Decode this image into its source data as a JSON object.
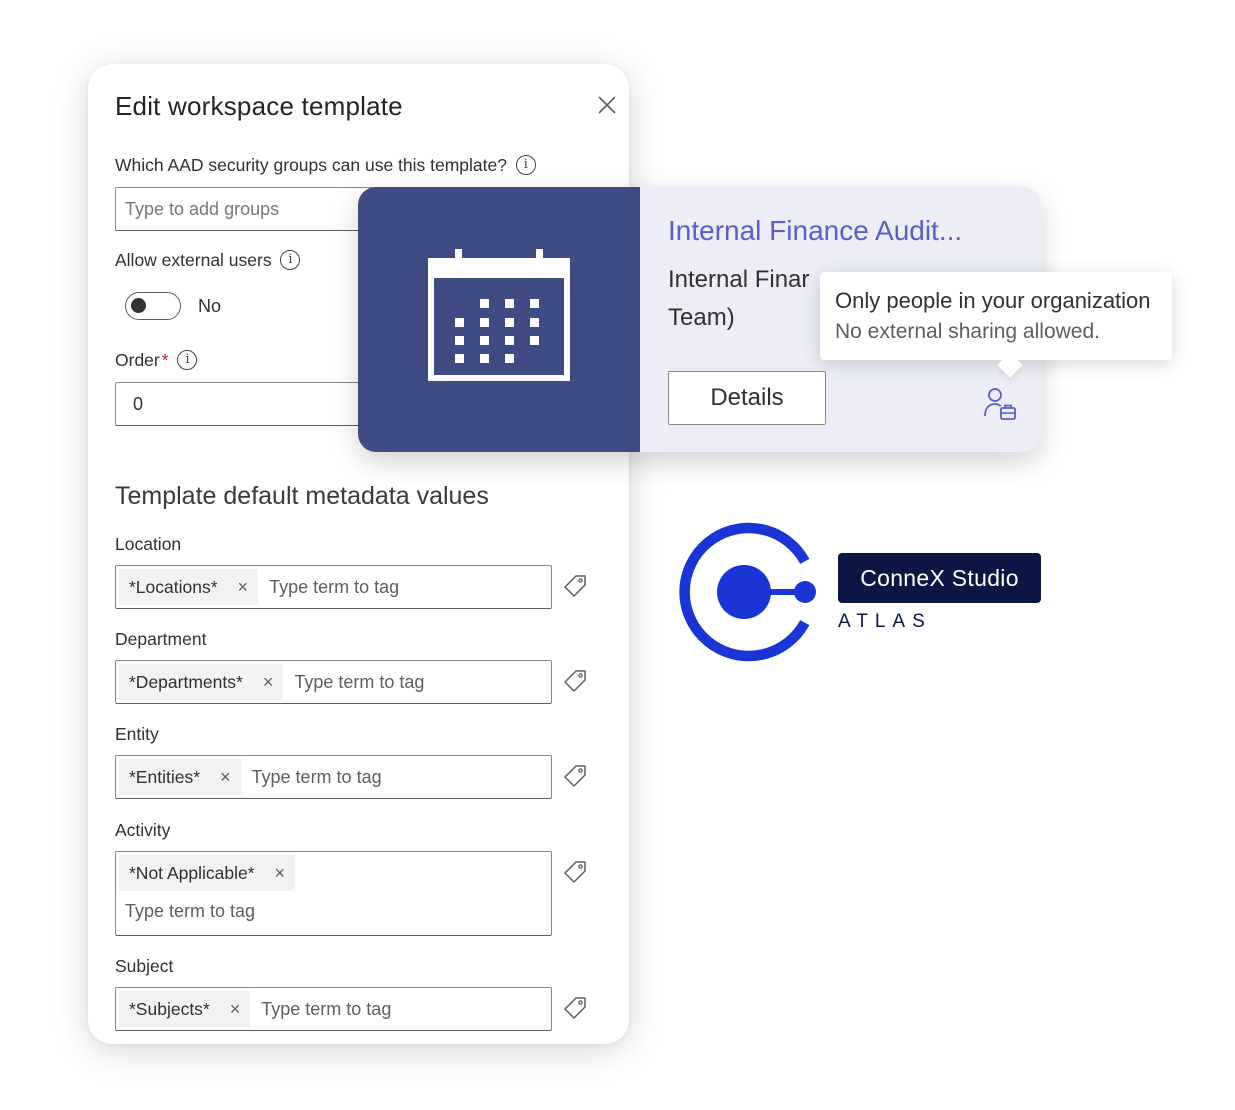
{
  "dialog": {
    "title": "Edit workspace template",
    "groups_label": "Which AAD security groups can use this template?",
    "groups_placeholder": "Type to add groups",
    "external_label": "Allow external users",
    "external_value": "No",
    "order_label": "Order",
    "order_required_mark": "*",
    "order_value": "0",
    "metadata_title": "Template default metadata values",
    "fields": [
      {
        "label": "Location",
        "chip": "*Locations*",
        "placeholder": "Type term to tag"
      },
      {
        "label": "Department",
        "chip": "*Departments*",
        "placeholder": "Type term to tag"
      },
      {
        "label": "Entity",
        "chip": "*Entities*",
        "placeholder": "Type term to tag"
      },
      {
        "label": "Activity",
        "chip": "*Not Applicable*",
        "placeholder": "Type term to tag"
      },
      {
        "label": "Subject",
        "chip": "*Subjects*",
        "placeholder": "Type term to tag"
      }
    ]
  },
  "card": {
    "title": "Internal Finance Audit...",
    "desc_line1": "Internal Finar",
    "desc_line2": "Team)",
    "details_label": "Details",
    "banner_icon": "calendar-icon",
    "banner_color": "#3f4c84",
    "title_color": "#5b5fc7"
  },
  "tooltip": {
    "line1": "Only people in your organization",
    "line2": "No external sharing allowed."
  },
  "brand": {
    "name": "ConneX Studio",
    "sub": "ATLAS",
    "accent": "#1a35d6",
    "badge_color": "#0c1645"
  },
  "icons": {
    "close": "close-icon",
    "info": "info-icon",
    "tag": "tag-icon",
    "person": "person-lock-icon",
    "chip_remove": "×",
    "info_glyph": "i"
  }
}
